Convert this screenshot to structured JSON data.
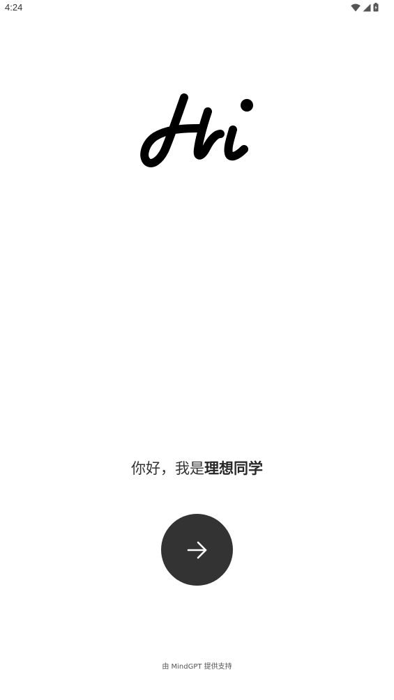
{
  "status_bar": {
    "time": "4:24",
    "icons": [
      "wifi-icon",
      "cellular-signal-icon",
      "battery-charging-icon"
    ]
  },
  "logo": {
    "text": "Hi"
  },
  "greeting": {
    "prefix": "你好，我是",
    "name": "理想同学"
  },
  "next_button": {
    "icon": "arrow-right-icon",
    "background": "#333333"
  },
  "footer": {
    "text": "由 MindGPT 提供支持"
  }
}
